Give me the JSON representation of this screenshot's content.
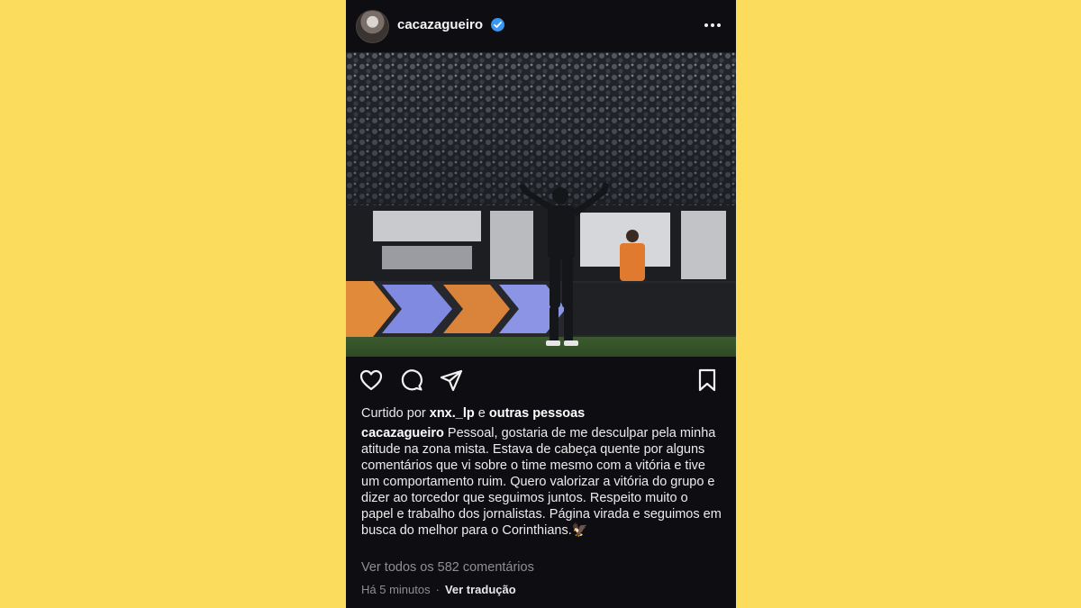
{
  "header": {
    "username": "cacazagueiro",
    "verified": true,
    "more_icon": "more-horizontal-icon"
  },
  "actions": {
    "icons": [
      "heart-icon",
      "comment-icon",
      "share-icon",
      "bookmark-icon"
    ]
  },
  "likes": {
    "prefix": "Curtido por ",
    "user": "xnx._lp",
    "middle": " e ",
    "others": "outras pessoas"
  },
  "caption": {
    "user": "cacazagueiro",
    "text": "Pessoal, gostaria de me desculpar pela minha atitude na zona mista. Estava de cabeça quente por alguns comentários que vi sobre o time mesmo com a vitória e tive um comportamento ruim. Quero valorizar a vitória do grupo e dizer ao torcedor que seguimos juntos. Respeito muito o papel e trabalho dos jornalistas. Página virada e seguimos em busca do melhor para o Corinthians.🦅"
  },
  "comments": {
    "view_all": "Ver todos os 582 comentários"
  },
  "meta": {
    "time": "Há 5 minutos",
    "separator": "·",
    "translate": "Ver tradução"
  },
  "colors": {
    "background": "#fcdc5c",
    "post_bg": "#0e0e12",
    "verified": "#3897f0"
  }
}
